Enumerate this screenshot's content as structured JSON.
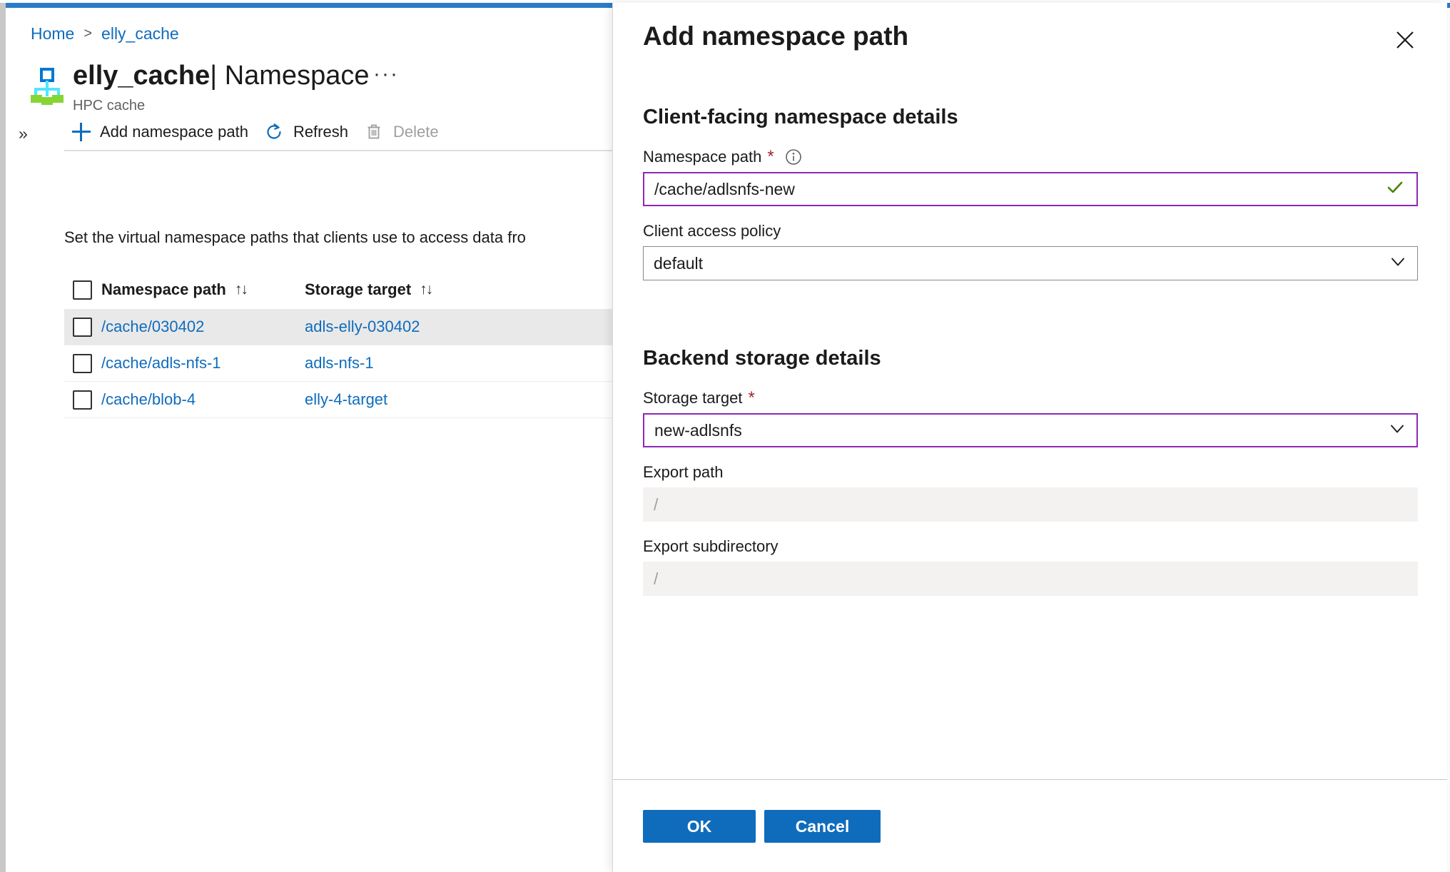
{
  "theme": {
    "accent_blue": "#0f6cbd",
    "top_bar_blue": "#2a7cc7",
    "focus_purple": "#8f28b8",
    "required_red": "#a4262c",
    "valid_green": "#498205",
    "disabled_gray": "#a19f9d",
    "selected_row_gray": "#e9e9e9"
  },
  "breadcrumb": {
    "home": "Home",
    "separator": ">",
    "current": "elly_cache"
  },
  "header": {
    "resource_icon": "hpc-cache-icon",
    "resource_name": "elly_cache",
    "divider": "|",
    "section": "Namespace",
    "subtitle": "HPC cache",
    "more_commands": "···"
  },
  "toolbar": {
    "expand_chevron": "»",
    "items": [
      {
        "label": "Add namespace path",
        "icon": "plus-icon",
        "disabled": false
      },
      {
        "label": "Refresh",
        "icon": "refresh-icon",
        "disabled": false
      },
      {
        "label": "Delete",
        "icon": "trash-icon",
        "disabled": true
      }
    ]
  },
  "blade": {
    "description": "Set the virtual namespace paths that clients use to access data fro"
  },
  "table": {
    "sort_glyph": "↑↓",
    "columns": [
      {
        "key": "namespace_path",
        "label": "Namespace path",
        "sortable": true
      },
      {
        "key": "storage_target",
        "label": "Storage target",
        "sortable": true
      }
    ],
    "rows": [
      {
        "namespace_path": "/cache/030402",
        "storage_target": "adls-elly-030402",
        "selected": true
      },
      {
        "namespace_path": "/cache/adls-nfs-1",
        "storage_target": "adls-nfs-1",
        "selected": false
      },
      {
        "namespace_path": "/cache/blob-4",
        "storage_target": "elly-4-target",
        "selected": false
      }
    ]
  },
  "panel": {
    "title": "Add namespace path",
    "close_icon": "close-icon",
    "sections": [
      {
        "title": "Client-facing namespace details",
        "fields": [
          {
            "label": "Namespace path",
            "required": true,
            "info_icon": "info-icon",
            "type": "text",
            "value": "/cache/adlsnfs-new",
            "state": "focused-valid",
            "validation_icon": "checkmark-icon"
          },
          {
            "label": "Client access policy",
            "required": false,
            "type": "select",
            "value": "default",
            "state": "normal",
            "chevron": "chevron-down-icon"
          }
        ]
      },
      {
        "title": "Backend storage details",
        "fields": [
          {
            "label": "Storage target",
            "required": true,
            "type": "select",
            "value": "new-adlsnfs",
            "state": "focused",
            "chevron": "chevron-down-icon"
          },
          {
            "label": "Export path",
            "required": false,
            "type": "text",
            "value": "/",
            "state": "disabled"
          },
          {
            "label": "Export subdirectory",
            "required": false,
            "type": "text",
            "value": "/",
            "state": "disabled"
          }
        ]
      }
    ],
    "footer": {
      "ok_label": "OK",
      "cancel_label": "Cancel"
    }
  }
}
